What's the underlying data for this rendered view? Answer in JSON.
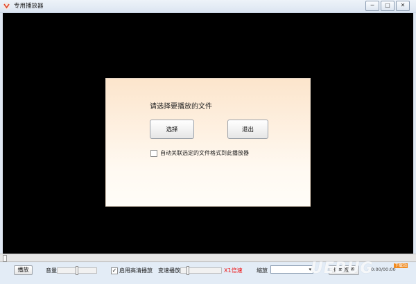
{
  "window": {
    "title": "专用播放器",
    "minimize_glyph": "─",
    "maximize_glyph": "□",
    "close_glyph": "✕"
  },
  "dialog": {
    "prompt": "请选择要播放的文件",
    "select_button": "选择",
    "exit_button": "退出",
    "auto_associate_label": "自动关联选定的文件格式到此播放器",
    "auto_associate_checked": false
  },
  "controls": {
    "play_button": "播放",
    "volume_label": "音量",
    "volume_level": 0.5,
    "hd_label": "启用高清播放",
    "hd_checked": true,
    "hd_check_glyph": "✓",
    "speed_label": "变速播放",
    "speed_level": 0.15,
    "speed_value": "X1倍速",
    "zoom_label": "缩放",
    "zoom_value": "",
    "zoom_arrow": "▾",
    "fullscreen_button": "切换视图",
    "time_display": "00:00/00:00"
  },
  "watermark": {
    "text": "UEBUG",
    "sub": "下载站"
  },
  "colors": {
    "video_bg": "#000000",
    "speed_text": "#ee1111",
    "dialog_gradient_top": "#fce5cc",
    "controls_bg": "#e3ecf6"
  },
  "icons": {
    "app": "play-logo-icon"
  }
}
